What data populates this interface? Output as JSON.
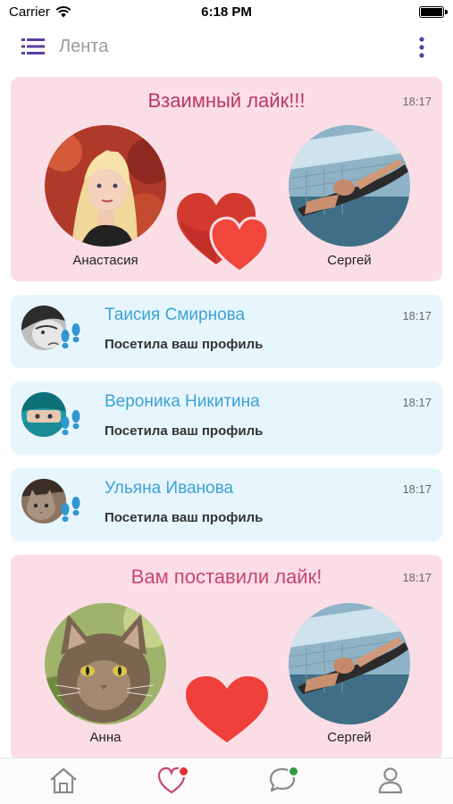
{
  "status_bar": {
    "carrier": "Carrier",
    "time": "6:18 PM",
    "battery_level": 1.0
  },
  "header": {
    "title": "Лента"
  },
  "feed": {
    "mutual_like": {
      "title": "Взаимный лайк!!!",
      "time": "18:17",
      "left_name": "Анастасия",
      "right_name": "Сергей"
    },
    "visits": [
      {
        "name": "Таисия Смирнова",
        "action": "Посетила ваш профиль",
        "time": "18:17"
      },
      {
        "name": "Вероника Никитина",
        "action": "Посетила ваш профиль",
        "time": "18:17"
      },
      {
        "name": "Ульяна Иванова",
        "action": "Посетила ваш профиль",
        "time": "18:17"
      }
    ],
    "like": {
      "title": "Вам поставили лайк!",
      "time": "18:17",
      "left_name": "Анна",
      "right_name": "Сергей"
    }
  },
  "tab_bar": {
    "tabs": [
      {
        "icon": "home-icon"
      },
      {
        "icon": "heart-icon",
        "badge_color": "#e8303a"
      },
      {
        "icon": "chat-icon",
        "badge_color": "#2e9a3e"
      },
      {
        "icon": "profile-icon"
      }
    ]
  },
  "colors": {
    "accent": "#5b3fa0",
    "mutual_title": "#b7386a",
    "like_title": "#c6476f",
    "visit_name": "#3ca2d6",
    "heart_red": "#e8403a",
    "pink_card": "#fbdde6",
    "blue_card": "#e7f6fd"
  }
}
